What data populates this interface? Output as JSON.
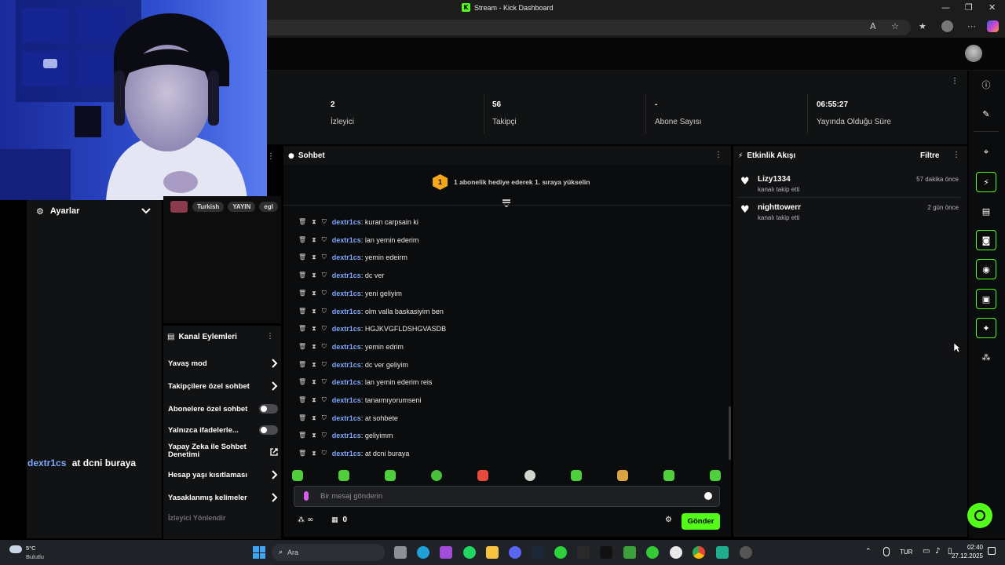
{
  "window": {
    "title": "Stream - Kick Dashboard",
    "controls": [
      "—",
      "❐",
      "✕"
    ]
  },
  "stats": [
    {
      "value": "2",
      "label": "İzleyici"
    },
    {
      "value": "56",
      "label": "Takipçi"
    },
    {
      "value": "-",
      "label": "Abone Sayısı"
    },
    {
      "value": "06:55:27",
      "label": "Yayında Olduğu Süre"
    }
  ],
  "left_panel": {
    "settings_label": "Ayarlar",
    "overlay_user": "dextr1cs",
    "overlay_msg": "at dcni buraya"
  },
  "tags": [
    "Turkish",
    "YAYIN",
    "egl"
  ],
  "channel_actions": {
    "title": "Kanal Eylemleri",
    "items": [
      {
        "label": "Yavaş mod",
        "control": "chevron"
      },
      {
        "label": "Takipçilere özel sohbet",
        "control": "chevron"
      },
      {
        "label": "Abonelere özel sohbet",
        "control": "toggle"
      },
      {
        "label": "Yalnızca ifadelerle...",
        "control": "toggle"
      },
      {
        "label": "Yapay Zeka ile Sohbet Denetimi",
        "control": "external"
      },
      {
        "label": "Hesap yaşı kısıtlaması",
        "control": "chevron"
      },
      {
        "label": "Yasaklanmış kelimeler",
        "control": "chevron"
      }
    ],
    "section_label": "İzleyici Yönlendir"
  },
  "chat": {
    "title": "Sohbet",
    "banner_rank": "1",
    "banner_text": "1 abonelik hediye ederek 1. sıraya yükselin",
    "messages": [
      {
        "user": "dextr1cs",
        "text": ": kuran carpsain ki"
      },
      {
        "user": "dextr1cs",
        "text": ": lan yemin ederim"
      },
      {
        "user": "dextr1cs",
        "text": ": yemin edeirm"
      },
      {
        "user": "dextr1cs",
        "text": ": dc ver"
      },
      {
        "user": "dextr1cs",
        "text": ": yeni geliyim"
      },
      {
        "user": "dextr1cs",
        "text": ": olm valla baskasiyim ben"
      },
      {
        "user": "dextr1cs",
        "text": ": HGJKVGFLDSHGVASDB"
      },
      {
        "user": "dextr1cs",
        "text": ": yemin edrim"
      },
      {
        "user": "dextr1cs",
        "text": ": dc ver geliyim"
      },
      {
        "user": "dextr1cs",
        "text": ": lan yemin ederim reis"
      },
      {
        "user": "dextr1cs",
        "text": ": tanaımıyorumseni"
      },
      {
        "user": "dextr1cs",
        "text": ": at sohbete"
      },
      {
        "user": "dextr1cs",
        "text": ": geliyimm"
      },
      {
        "user": "dextr1cs",
        "text": ": at dcni buraya"
      }
    ],
    "input_placeholder": "Bir mesaj gönderin",
    "points_value": "∞",
    "store_count": "0",
    "send_label": "Gönder"
  },
  "activity": {
    "title": "Etkinlik Akışı",
    "filter_label": "Filtre",
    "events": [
      {
        "user": "Lizy1334",
        "action": "kanalı takip etti",
        "time": "57 dakika önce"
      },
      {
        "user": "nighttowerr",
        "action": "kanalı takip etti",
        "time": "2 gün önce"
      }
    ]
  },
  "taskbar": {
    "weather_temp": "5°C",
    "weather_desc": "Bulutlu",
    "search_label": "Ara",
    "lang": "TUR",
    "time": "02:40",
    "date": "27.12.2025"
  },
  "colors": {
    "accent": "#53fc18",
    "username": "#7fa8ff",
    "panel": "#111213",
    "background": "#000000"
  }
}
